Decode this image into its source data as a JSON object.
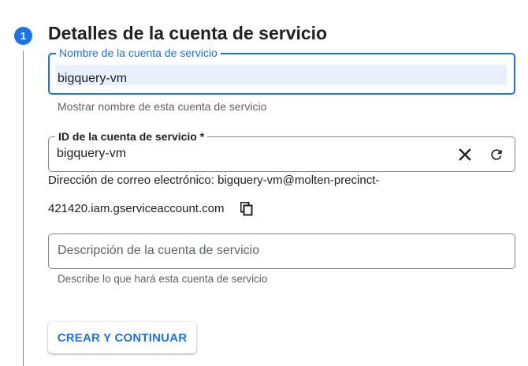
{
  "step": {
    "number": "1",
    "title": "Detalles de la cuenta de servicio"
  },
  "name_field": {
    "label": "Nombre de la cuenta de servicio",
    "value": "bigquery-vm",
    "hint": "Mostrar nombre de esta cuenta de servicio"
  },
  "id_field": {
    "label": "ID de la cuenta de servicio *",
    "value": "bigquery-vm",
    "clear_icon": "close-icon",
    "refresh_icon": "refresh-icon"
  },
  "email": {
    "line1": "Dirección de correo electrónico: bigquery-vm@molten-precinct-",
    "line2": "421420.iam.gserviceaccount.com",
    "copy_icon": "copy-icon"
  },
  "description_field": {
    "placeholder": "Descripción de la cuenta de servicio",
    "hint": "Describe lo que hará esta cuenta de servicio"
  },
  "actions": {
    "continue_label": "CREAR Y CONTINUAR"
  },
  "colors": {
    "accent": "#1a73e8",
    "autofill": "#e8f0fe",
    "text": "#202124",
    "secondary_text": "#5f6368"
  }
}
